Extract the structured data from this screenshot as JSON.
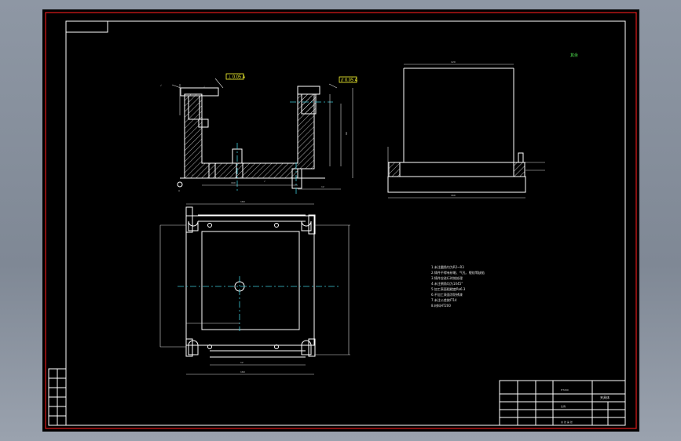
{
  "drawing": {
    "notes": [
      "1.未注圆角均为R2~R3",
      "2.铸件不得有砂眼、气孔、裂纹等缺陷",
      "3.铸件应进行时效处理",
      "4.未注倒角均为1X45°",
      "5.加工表面粗糙度Ra6.3",
      "6.不加工表面涂防锈漆",
      "7.未注公差按IT14",
      "8.材料HT200"
    ],
    "roughness_mark": "其余",
    "gdt_left": "⊥ 0.05 A",
    "gdt_right": "// 0.05 A",
    "datum_label": "A",
    "title_block": {
      "part_name": "夹具体",
      "scale": "比例",
      "material": "HT200",
      "sheet": "共 张 第 张"
    },
    "dims": {
      "top_view_width": "160",
      "front_width": "160",
      "side_width": "160",
      "side_top": "120",
      "height": "90",
      "slot": "12"
    }
  },
  "colors": {
    "background": "#000000",
    "frame": "#e01c1c",
    "line": "#ffffff",
    "centerline": "#3cc7d6",
    "callout": "#ffff33",
    "app_chrome": "#8e97a4"
  }
}
